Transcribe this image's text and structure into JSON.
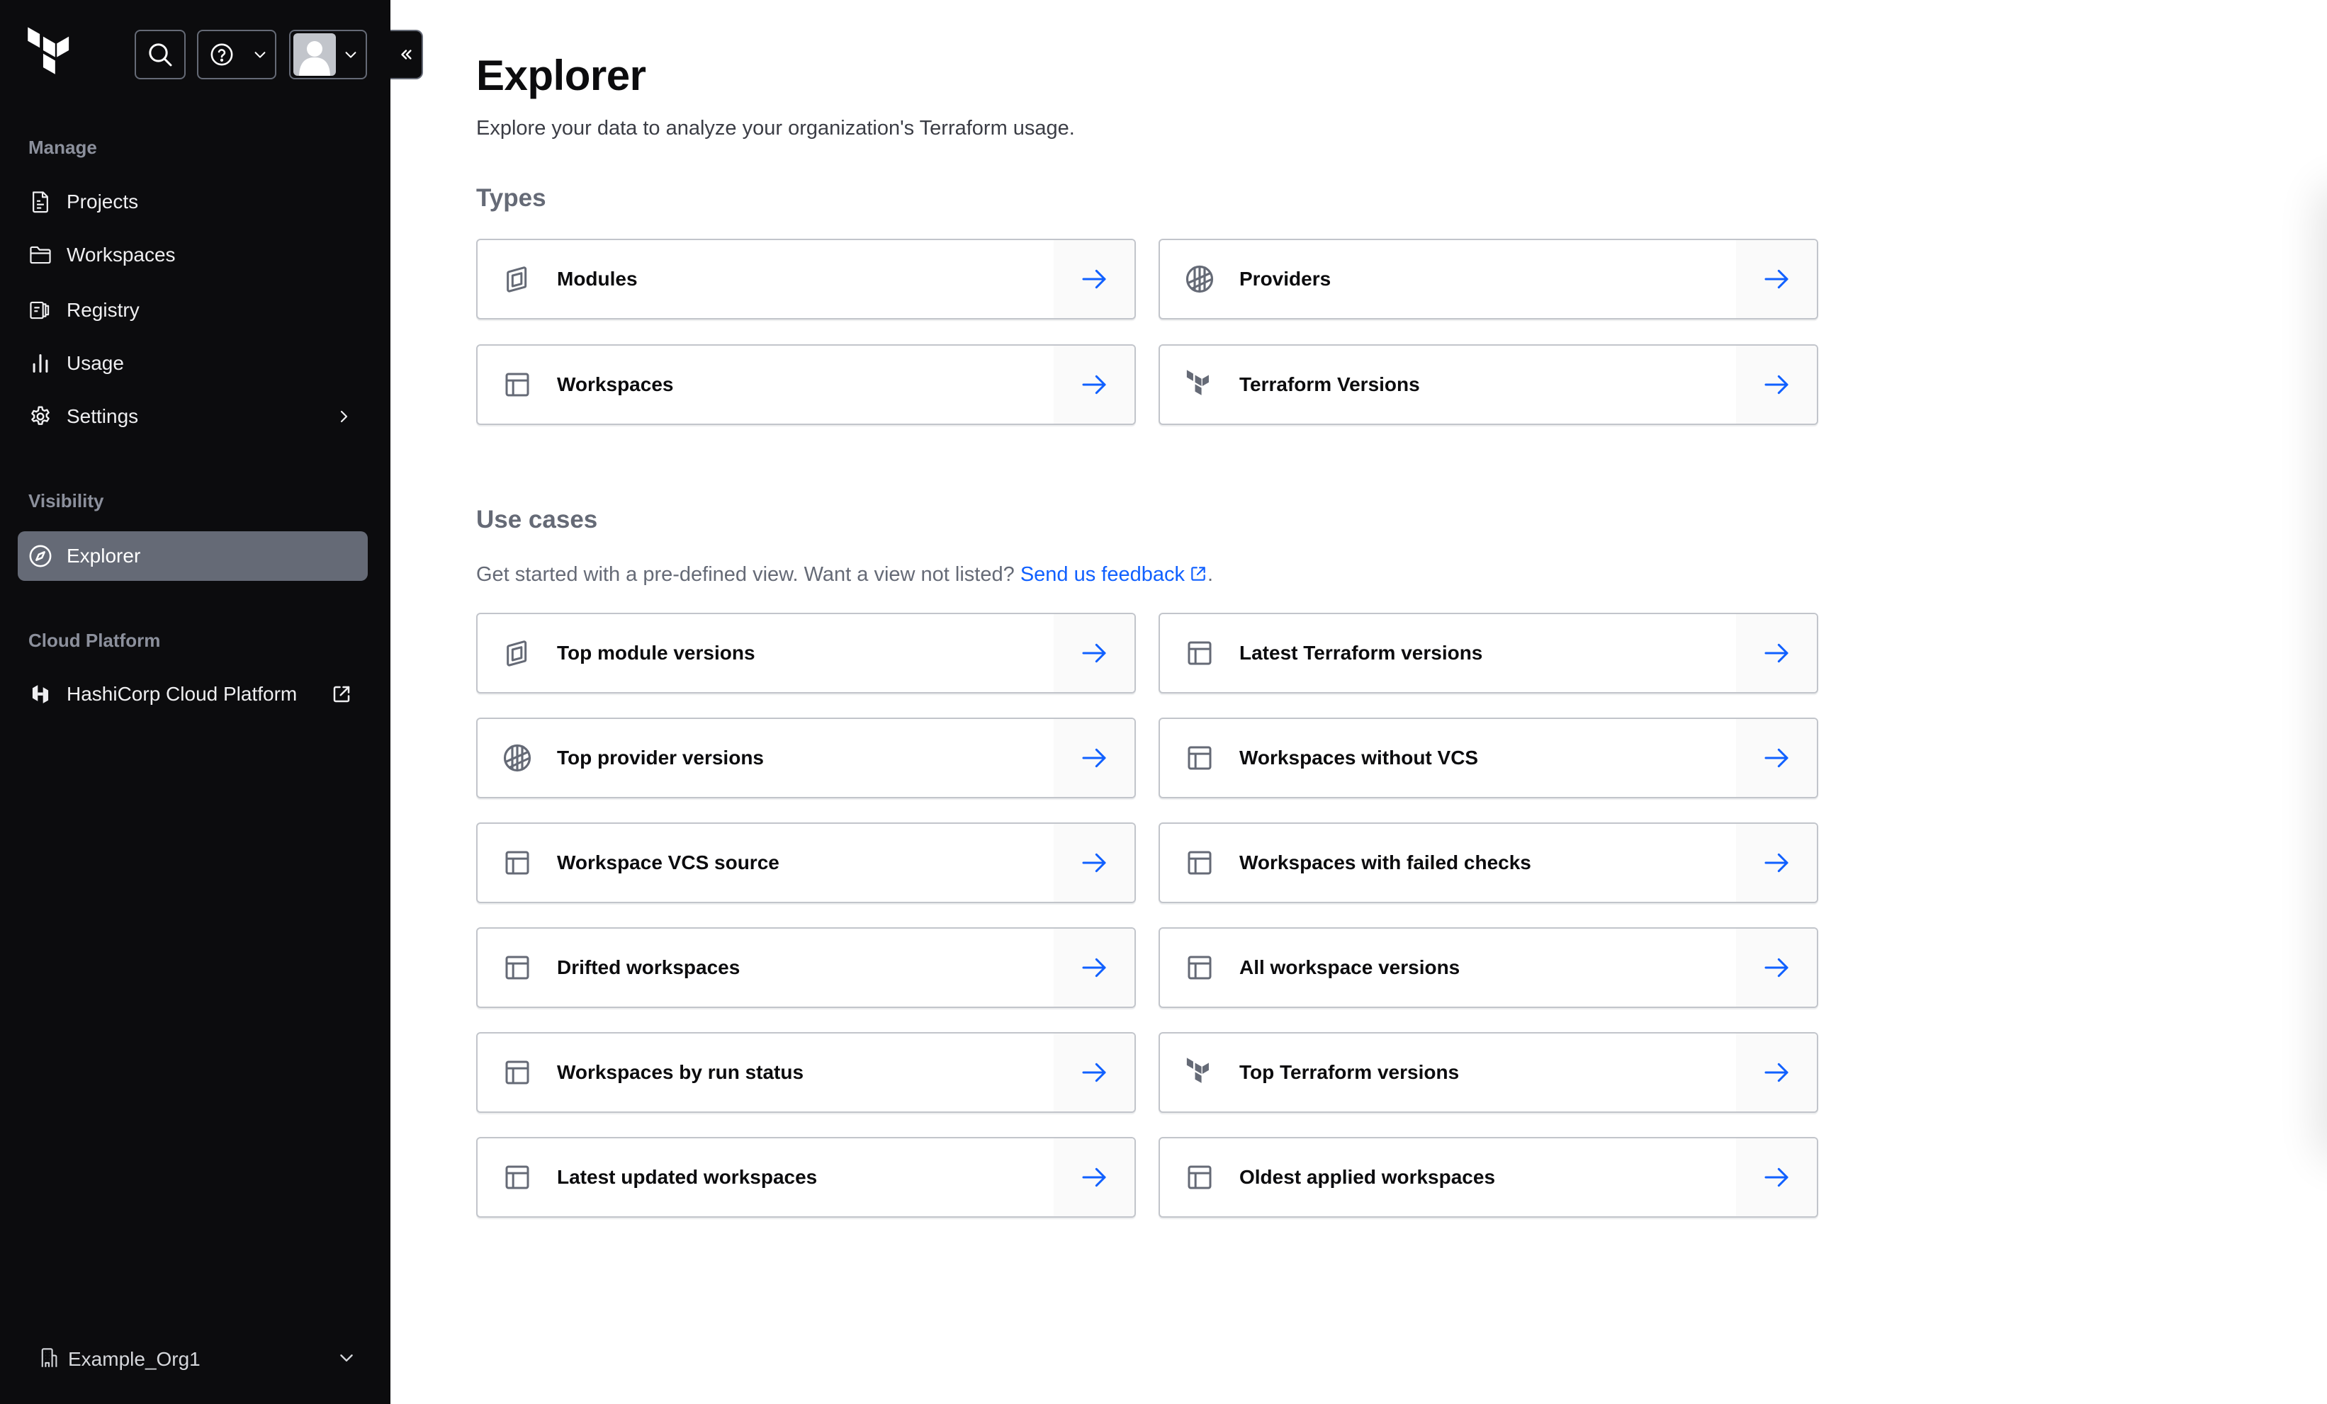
{
  "header": {
    "search_label": "Search",
    "help_label": "Help",
    "user_menu_label": "User menu",
    "collapse_label": "Collapse sidebar"
  },
  "sidebar": {
    "sections": [
      {
        "label": "Manage",
        "items": [
          {
            "label": "Projects",
            "icon": "file-text-icon"
          },
          {
            "label": "Workspaces",
            "icon": "folder-icon"
          },
          {
            "label": "Registry",
            "icon": "registry-icon"
          },
          {
            "label": "Usage",
            "icon": "bar-chart-icon"
          },
          {
            "label": "Settings",
            "icon": "gear-icon",
            "trailing": "chevron-right-icon"
          }
        ]
      },
      {
        "label": "Visibility",
        "items": [
          {
            "label": "Explorer",
            "icon": "compass-icon",
            "active": true
          }
        ]
      },
      {
        "label": "Cloud Platform",
        "items": [
          {
            "label": "HashiCorp Cloud Platform",
            "icon": "hashicorp-icon",
            "trailing": "external-link-icon"
          }
        ]
      }
    ],
    "org": {
      "label": "Example_Org1",
      "icon": "building-icon"
    }
  },
  "main": {
    "title": "Explorer",
    "description": "Explore your data to analyze your organization's Terraform usage.",
    "types": {
      "heading": "Types",
      "cards": [
        {
          "label": "Modules",
          "icon": "module-icon"
        },
        {
          "label": "Providers",
          "icon": "provider-icon"
        },
        {
          "label": "Workspaces",
          "icon": "workspace-icon"
        },
        {
          "label": "Terraform Versions",
          "icon": "terraform-icon"
        }
      ]
    },
    "use_cases": {
      "heading": "Use cases",
      "description_prefix": "Get started with a pre-defined view. Want a view not listed?",
      "feedback_link": "Send us feedback",
      "description_suffix": ".",
      "cards": [
        {
          "label": "Top module versions",
          "icon": "module-icon"
        },
        {
          "label": "Latest Terraform versions",
          "icon": "workspace-icon"
        },
        {
          "label": "Top provider versions",
          "icon": "provider-icon"
        },
        {
          "label": "Workspaces without VCS",
          "icon": "workspace-icon"
        },
        {
          "label": "Workspace VCS source",
          "icon": "workspace-icon"
        },
        {
          "label": "Workspaces with failed checks",
          "icon": "workspace-icon"
        },
        {
          "label": "Drifted workspaces",
          "icon": "workspace-icon"
        },
        {
          "label": "All workspace versions",
          "icon": "workspace-icon"
        },
        {
          "label": "Workspaces by run status",
          "icon": "workspace-icon"
        },
        {
          "label": "Top Terraform versions",
          "icon": "terraform-icon"
        },
        {
          "label": "Latest updated workspaces",
          "icon": "workspace-icon"
        },
        {
          "label": "Oldest applied workspaces",
          "icon": "workspace-icon"
        }
      ]
    }
  },
  "colors": {
    "sidebar_bg": "#0c0c0e",
    "active_nav_bg": "#656a76",
    "link": "#1060ff",
    "arrow": "#1060ff",
    "icon_gray": "#656a76",
    "card_border": "#c2c5cb"
  }
}
